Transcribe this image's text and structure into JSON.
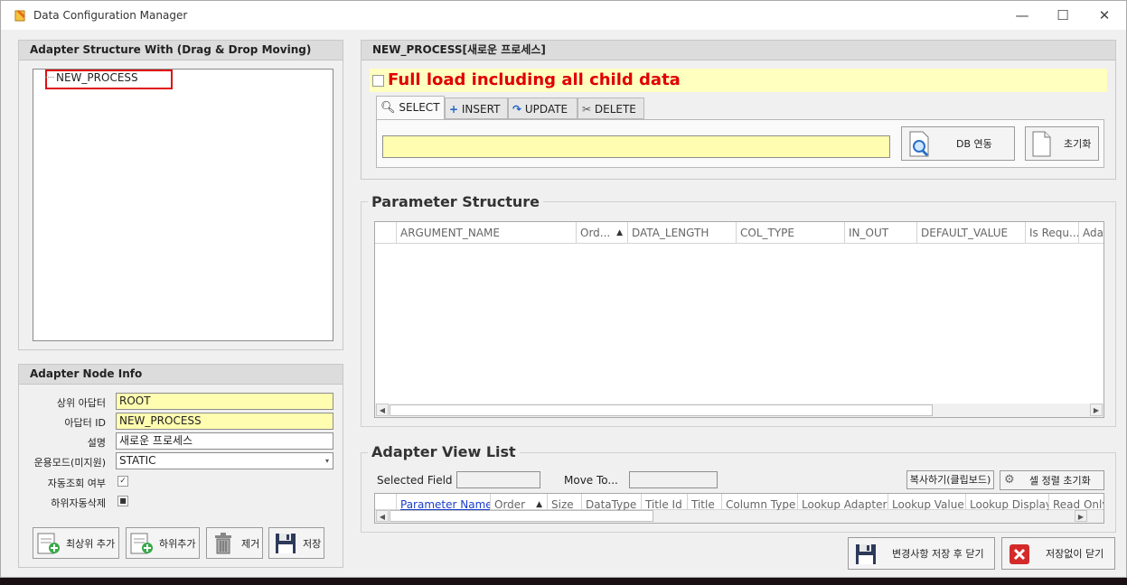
{
  "window": {
    "title": "Data Configuration Manager",
    "minimize_glyph": "—",
    "maximize_glyph": "☐",
    "close_glyph": "✕"
  },
  "adapter_structure": {
    "header": "Adapter Structure With (Drag & Drop Moving)",
    "tree_items": [
      "NEW_PROCESS"
    ]
  },
  "node_info": {
    "header": "Adapter Node Info",
    "parent_label": "상위 아답터",
    "parent_value": "ROOT",
    "id_label": "아답터 ID",
    "id_value": "NEW_PROCESS",
    "desc_label": "설명",
    "desc_value": "새로운 프로세스",
    "mode_label": "운용모드(미지원)",
    "mode_value": "STATIC",
    "auto_query_label": "자동조회 여부",
    "auto_query_checked": "✓",
    "child_delete_label": "하위자동삭제",
    "child_delete_checked": "■",
    "buttons": {
      "add_top": "최상위 추가",
      "add_child": "하위추가",
      "remove": "제거",
      "save": "저장"
    }
  },
  "process_panel": {
    "header": "NEW_PROCESS[새로운 프로세스]",
    "full_load_label": "Full load including all child data",
    "tabs": [
      "SELECT",
      "INSERT",
      "UPDATE",
      "DELETE"
    ],
    "active_tab": "SELECT",
    "query_value": "",
    "db_link_button": "DB 연동",
    "reset_button": "초기화"
  },
  "parameter_structure": {
    "title": "Parameter Structure",
    "columns": [
      "ARGUMENT_NAME",
      "Ord...",
      "DATA_LENGTH",
      "COL_TYPE",
      "IN_OUT",
      "DEFAULT_VALUE",
      "Is Requ...",
      "Adap"
    ]
  },
  "adapter_view_list": {
    "title": "Adapter View List",
    "selected_field_label": "Selected Field",
    "selected_field_value": "",
    "move_to_label": "Move To...",
    "move_to_value": "",
    "copy_button": "복사하기(클립보드)",
    "cell_sort_reset_button": "셀 정렬 초기화",
    "columns": [
      "Parameter Name",
      "Order",
      "Size",
      "DataType",
      "Title Id",
      "Title",
      "Column Type",
      "Lookup Adapter",
      "Lookup Value",
      "Lookup Display",
      "Read Only"
    ]
  },
  "footer": {
    "save_close_button": "변경사항 저장 후 닫기",
    "close_no_save_button": "저장없이 닫기"
  },
  "colors": {
    "accent_red": "#e00000",
    "highlight_yellow": "#fffdaf",
    "link_blue": "#1a3ccc"
  }
}
